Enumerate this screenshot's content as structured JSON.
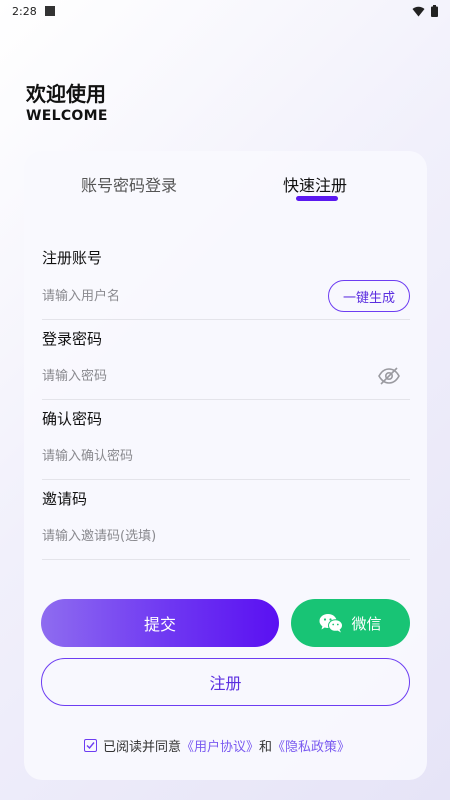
{
  "status_bar": {
    "time": "2:28"
  },
  "header": {
    "title": "欢迎使用",
    "subtitle": "WELCOME"
  },
  "tabs": [
    {
      "label": "账号密码登录",
      "active": false
    },
    {
      "label": "快速注册",
      "active": true
    }
  ],
  "form": {
    "account": {
      "label": "注册账号",
      "placeholder": "请输入用户名",
      "value": "",
      "generate_label": "一键生成"
    },
    "password": {
      "label": "登录密码",
      "placeholder": "请输入密码",
      "value": ""
    },
    "confirm": {
      "label": "确认密码",
      "placeholder": "请输入确认密码",
      "value": ""
    },
    "invite": {
      "label": "邀请码",
      "placeholder": "请输入邀请码(选填)",
      "value": ""
    }
  },
  "buttons": {
    "submit": "提交",
    "wechat": "微信",
    "register": "注册"
  },
  "agreement": {
    "checked": true,
    "prefix": "已阅读并同意",
    "user_agreement": "《用户协议》",
    "and": "和",
    "privacy_policy": "《隐私政策》"
  },
  "icons": {
    "wifi": "wifi-icon",
    "battery": "battery-icon",
    "eye": "eye-off-icon",
    "wechat": "wechat-icon",
    "check": "check-icon"
  },
  "colors": {
    "accent": "#5a18f0",
    "wechat": "#18c475",
    "link": "#7a5af0"
  }
}
